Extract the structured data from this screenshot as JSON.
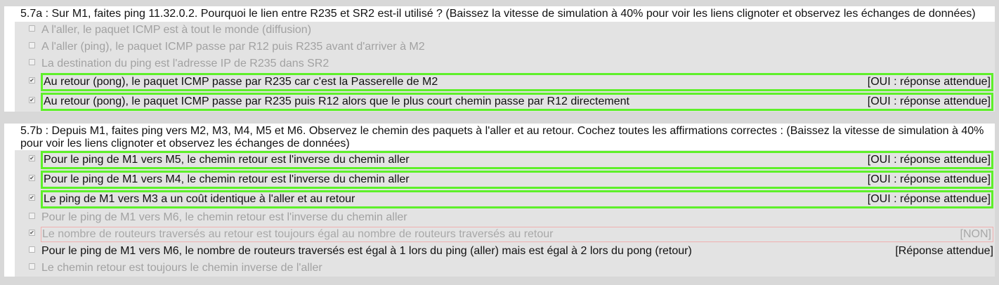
{
  "questions": [
    {
      "title": "5.7a : Sur M1, faites ping 11.32.0.2. Pourquoi le lien entre R235 et SR2 est-il utilisé ? (Baissez la vitesse de simulation à 40% pour voir les liens clignoter et observez les échanges de données)",
      "choices": [
        {
          "label": "A l'aller, le paquet ICMP est à tout le monde (diffusion)",
          "tag": "",
          "checked": false,
          "state": "grey"
        },
        {
          "label": "A l'aller (ping), le paquet ICMP passe par R12 puis R235 avant d'arriver à M2",
          "tag": "",
          "checked": false,
          "state": "grey"
        },
        {
          "label": "La destination du ping est l'adresse IP de R235 dans SR2",
          "tag": "",
          "checked": false,
          "state": "grey"
        },
        {
          "label": "Au retour (pong), le paquet ICMP passe par R235 car c'est la Passerelle de M2",
          "tag": "[OUI : réponse attendue]",
          "checked": true,
          "state": "good"
        },
        {
          "label": "Au retour (pong), le paquet ICMP passe par R235 puis R12 alors que le plus court chemin passe par R12 directement",
          "tag": "[OUI : réponse attendue]",
          "checked": true,
          "state": "good"
        }
      ]
    },
    {
      "title": "5.7b : Depuis M1, faites ping vers M2, M3, M4, M5 et M6. Observez le chemin des paquets à l'aller et au retour. Cochez toutes les affirmations correctes : (Baissez la vitesse de simulation à 40% pour voir les liens clignoter et observez les échanges de données)",
      "choices": [
        {
          "label": "Pour le ping de M1 vers M5, le chemin retour est l'inverse du chemin aller",
          "tag": "[OUI : réponse attendue]",
          "checked": true,
          "state": "good"
        },
        {
          "label": "Pour le ping de M1 vers M4, le chemin retour est l'inverse du chemin aller",
          "tag": "[OUI : réponse attendue]",
          "checked": true,
          "state": "good"
        },
        {
          "label": "Le ping de M1 vers M3 a un coût identique à l'aller et au retour",
          "tag": "[OUI : réponse attendue]",
          "checked": true,
          "state": "good"
        },
        {
          "label": "Pour le ping de M1 vers M6, le chemin retour est l'inverse du chemin aller",
          "tag": "",
          "checked": false,
          "state": "grey"
        },
        {
          "label": "Le nombre de routeurs traversés au retour est toujours égal au nombre de routeurs traversés au retour",
          "tag": "[NON]",
          "checked": true,
          "state": "bad"
        },
        {
          "label": "Pour le ping de M1 vers M6, le nombre de routeurs traversés est égal à 1 lors du ping (aller) mais est égal à 2 lors du pong (retour)",
          "tag": "[Réponse attendue]",
          "checked": false,
          "state": "dark"
        },
        {
          "label": "Le chemin retour est toujours le chemin inverse de l'aller",
          "tag": "",
          "checked": false,
          "state": "grey"
        }
      ]
    }
  ],
  "colors": {
    "good": "#5ef02a",
    "bad": "#f0b0b0",
    "panel": "#e3e3e3"
  }
}
